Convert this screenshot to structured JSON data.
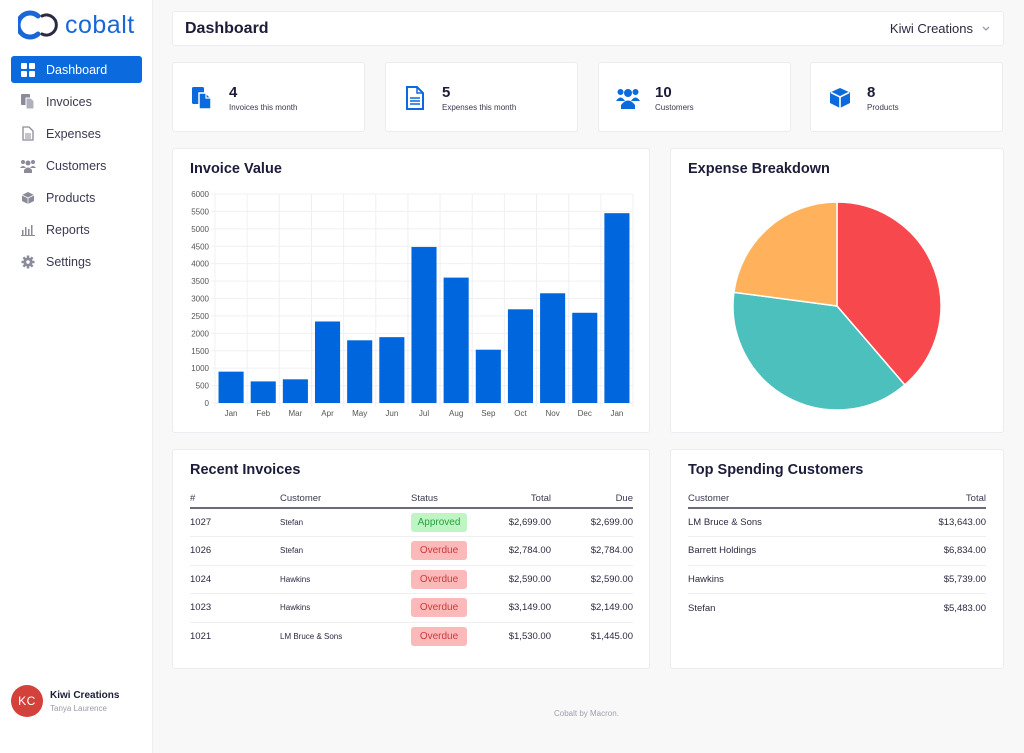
{
  "app": {
    "name": "cobalt"
  },
  "sidebar": {
    "items": [
      {
        "label": "Dashboard",
        "icon": "dashboard-grid-icon",
        "active": true
      },
      {
        "label": "Invoices",
        "icon": "invoices-icon"
      },
      {
        "label": "Expenses",
        "icon": "document-icon"
      },
      {
        "label": "Customers",
        "icon": "users-icon"
      },
      {
        "label": "Products",
        "icon": "box-icon"
      },
      {
        "label": "Reports",
        "icon": "bar-chart-icon"
      },
      {
        "label": "Settings",
        "icon": "gear-icon"
      }
    ],
    "user": {
      "initials": "KC",
      "name": "Kiwi Creations",
      "subtitle": "Tanya Laurence"
    }
  },
  "header": {
    "title": "Dashboard",
    "org": "Kiwi Creations"
  },
  "stats": [
    {
      "value": "4",
      "label": "Invoices this month",
      "icon": "invoices-icon"
    },
    {
      "value": "5",
      "label": "Expenses this month",
      "icon": "document-icon"
    },
    {
      "value": "10",
      "label": "Customers",
      "icon": "users-icon"
    },
    {
      "value": "8",
      "label": "Products",
      "icon": "box-icon"
    }
  ],
  "colors": {
    "accent": "#0b6ade",
    "bar": "#0066dd",
    "pie": [
      "#f7484e",
      "#4bc0bc",
      "#ffb25b"
    ]
  },
  "chart_data": [
    {
      "type": "bar",
      "title": "Invoice Value",
      "categories": [
        "Jan",
        "Feb",
        "Mar",
        "Apr",
        "May",
        "Jun",
        "Jul",
        "Aug",
        "Sep",
        "Oct",
        "Nov",
        "Dec",
        "Jan"
      ],
      "values": [
        900,
        620,
        680,
        2340,
        1800,
        1890,
        4480,
        3600,
        1530,
        2690,
        3150,
        2590,
        5450
      ],
      "yticks": [
        "0",
        "500",
        "1000",
        "1500",
        "2000",
        "2500",
        "3000",
        "3500",
        "4000",
        "4500",
        "5000",
        "5500",
        "6000"
      ],
      "ylim": [
        0,
        6000
      ],
      "grid": true,
      "xlabel": "",
      "ylabel": ""
    },
    {
      "type": "pie",
      "title": "Expense Breakdown",
      "values": [
        38.7,
        38.4,
        22.9
      ],
      "labels": [
        "",
        "",
        ""
      ]
    }
  ],
  "recent_invoices": {
    "title": "Recent Invoices",
    "columns": [
      "#",
      "Customer",
      "Status",
      "Total",
      "Due"
    ],
    "rows": [
      {
        "id": "1027",
        "customer": "Stefan",
        "status": "Approved",
        "total": "$2,699.00",
        "due": "$2,699.00"
      },
      {
        "id": "1026",
        "customer": "Stefan",
        "status": "Overdue",
        "total": "$2,784.00",
        "due": "$2,784.00"
      },
      {
        "id": "1024",
        "customer": "Hawkins",
        "status": "Overdue",
        "total": "$2,590.00",
        "due": "$2,590.00"
      },
      {
        "id": "1023",
        "customer": "Hawkins",
        "status": "Overdue",
        "total": "$3,149.00",
        "due": "$2,149.00"
      },
      {
        "id": "1021",
        "customer": "LM Bruce & Sons",
        "status": "Overdue",
        "total": "$1,530.00",
        "due": "$1,445.00"
      }
    ]
  },
  "top_customers": {
    "title": "Top Spending Customers",
    "columns": [
      "Customer",
      "Total"
    ],
    "rows": [
      {
        "customer": "LM Bruce & Sons",
        "total": "$13,643.00"
      },
      {
        "customer": "Barrett Holdings",
        "total": "$6,834.00"
      },
      {
        "customer": "Hawkins",
        "total": "$5,739.00"
      },
      {
        "customer": "Stefan",
        "total": "$5,483.00"
      }
    ]
  },
  "footer": {
    "text": "Cobalt by Macron."
  }
}
